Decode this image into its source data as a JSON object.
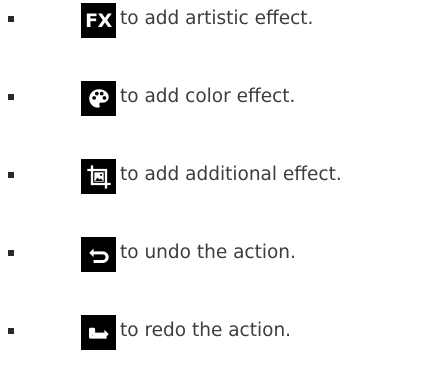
{
  "items": [
    {
      "icon": "fx-icon",
      "icon_text": "FX",
      "label": "to add artistic effect."
    },
    {
      "icon": "palette-icon",
      "label": "to add color effect."
    },
    {
      "icon": "crop-image-icon",
      "label": "to add additional effect."
    },
    {
      "icon": "undo-icon",
      "label": "to undo the action."
    },
    {
      "icon": "redo-icon",
      "label": "to redo the action."
    }
  ],
  "colors": {
    "icon_background": "#000000",
    "icon_foreground": "#ffffff",
    "text": "#3c3c3c",
    "bullet": "#2a2a2a"
  }
}
